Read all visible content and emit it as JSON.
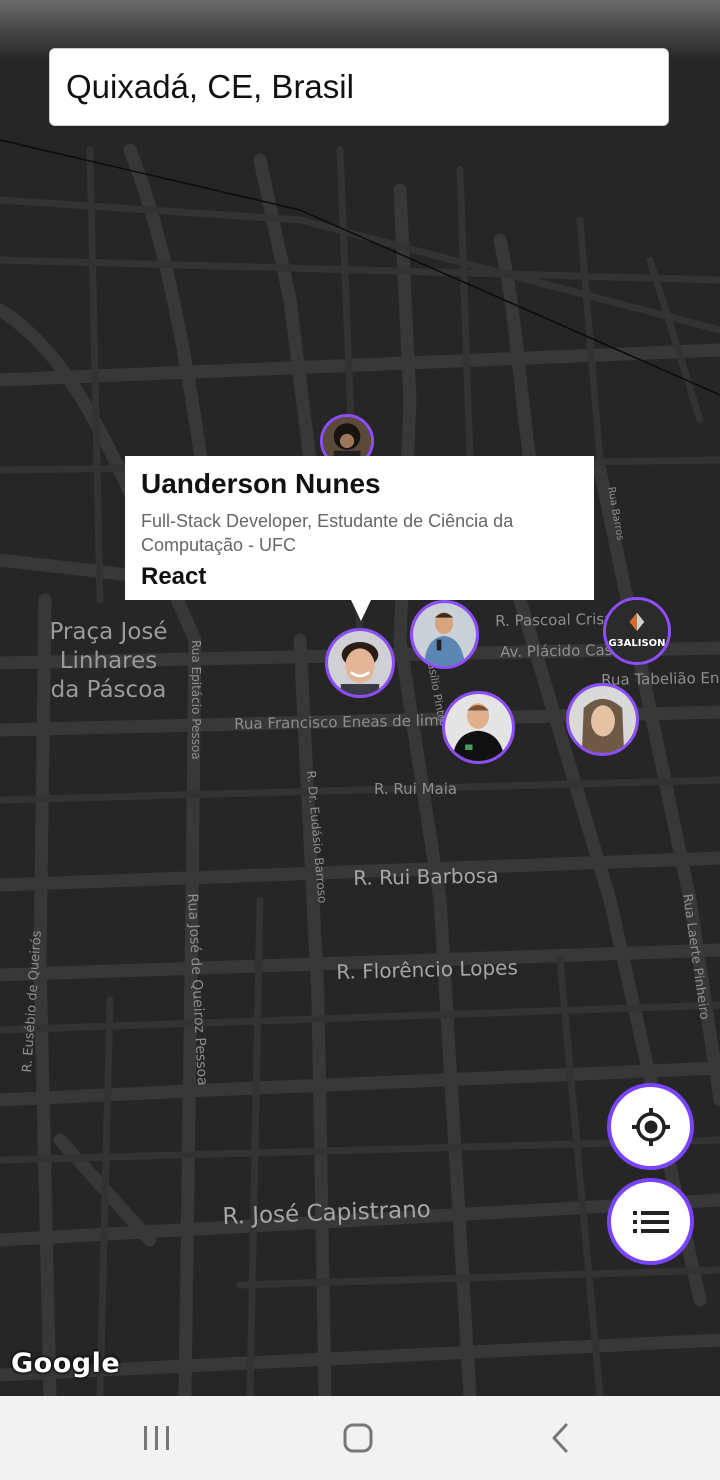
{
  "search": {
    "value": "Quixadá, CE, Brasil"
  },
  "map": {
    "place": "Praça José\nLinhares\nda Páscoa",
    "streets": {
      "pascoal_crispim": "R. Pascoal Crispim",
      "placido_castelo": "Av. Plácido Castelo",
      "tabeliao": "Rua Tabelião Enéas",
      "francisco_eneas": "Rua Francisco Eneas de lima",
      "rui_maia": "R. Rui Maia",
      "rui_barbosa": "R. Rui Barbosa",
      "florencio_lopes": "R. Florêncio Lopes",
      "jose_capistrano": "R. José Capistrano",
      "epitacio_pessoa": "Rua Epitácio Pessoa",
      "basilio_pinto": "R. Basílio Pinto",
      "eudasio_barroso": "R. Dr. Eudásio Barroso",
      "jose_queiroz": "Rua José de Queiroz Pessoa",
      "eusebio_queiros": "R. Eusébio de Queirós",
      "laerte_pinheiro": "Rua Laerte Pinheiro",
      "top_road": "Rua Barros"
    },
    "attribution": "Google"
  },
  "pins": [
    {
      "id": "dev-top",
      "icon": "avatar-curly-hair"
    },
    {
      "id": "dev-uanderson",
      "icon": "avatar-young-man"
    },
    {
      "id": "dev-speaker",
      "icon": "avatar-microphone"
    },
    {
      "id": "dev-glasses",
      "icon": "avatar-black-shirt"
    },
    {
      "id": "dev-long-hair",
      "icon": "avatar-long-hair"
    },
    {
      "id": "dev-gealison",
      "logo": "G3ALISON"
    }
  ],
  "callout": {
    "name": "Uanderson Nunes",
    "bio": "Full-Stack Developer, Estudante de Ciência da Computação - UFC",
    "techs": "React"
  },
  "buttons": {
    "locate_icon": "crosshair-icon",
    "list_icon": "list-icon"
  },
  "navbar": {
    "recents_icon": "recent-apps-icon",
    "home_icon": "home-icon",
    "back_icon": "back-icon"
  },
  "colors": {
    "accent": "#7a44ff",
    "map_bg": "#262626",
    "road": "#3a3a3a"
  }
}
